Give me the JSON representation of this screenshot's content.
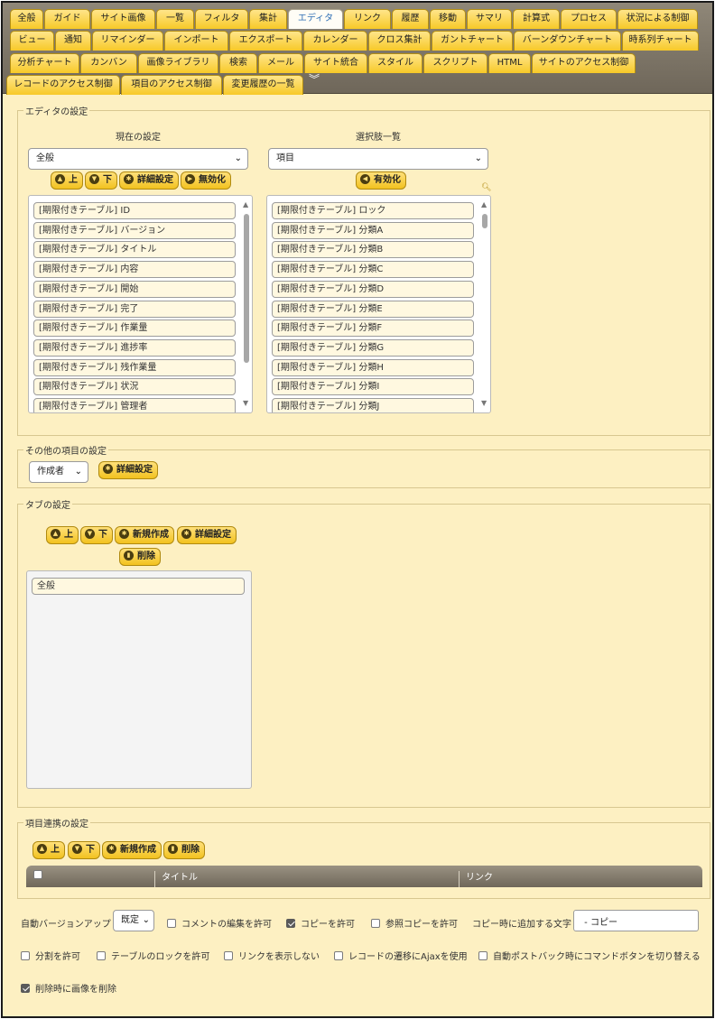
{
  "tabs_row1": [
    "全般",
    "ガイド",
    "サイト画像",
    "一覧",
    "フィルタ",
    "集計",
    "エディタ",
    "リンク",
    "履歴",
    "移動",
    "サマリ",
    "計算式",
    "プロセス",
    "状況による制御"
  ],
  "tabs_row2": [
    "ビュー",
    "通知",
    "リマインダー",
    "インポート",
    "エクスポート",
    "カレンダー",
    "クロス集計",
    "ガントチャート",
    "バーンダウンチャート",
    "時系列チャート"
  ],
  "tabs_row3": [
    "分析チャート",
    "カンバン",
    "画像ライブラリ",
    "検索",
    "メール",
    "サイト統合",
    "スタイル",
    "スクリプト",
    "HTML",
    "サイトのアクセス制御"
  ],
  "tabs_row4": [
    "レコードのアクセス制御",
    "項目のアクセス制御",
    "変更履歴の一覧"
  ],
  "active_tab": "エディタ",
  "editor_settings": {
    "legend": "エディタの設定",
    "current_heading": "現在の設定",
    "choices_heading": "選択肢一覧",
    "current_select": "全般",
    "choices_select": "項目",
    "btn_up": "上",
    "btn_down": "下",
    "btn_advanced": "詳細設定",
    "btn_disable": "無効化",
    "btn_enable": "有効化",
    "current_items": [
      "[期限付きテーブル] ID",
      "[期限付きテーブル] バージョン",
      "[期限付きテーブル] タイトル",
      "[期限付きテーブル] 内容",
      "[期限付きテーブル] 開始",
      "[期限付きテーブル] 完了",
      "[期限付きテーブル] 作業量",
      "[期限付きテーブル] 進捗率",
      "[期限付きテーブル] 残作業量",
      "[期限付きテーブル] 状況",
      "[期限付きテーブル] 管理者"
    ],
    "choice_items": [
      "[期限付きテーブル] ロック",
      "[期限付きテーブル] 分類A",
      "[期限付きテーブル] 分類B",
      "[期限付きテーブル] 分類C",
      "[期限付きテーブル] 分類D",
      "[期限付きテーブル] 分類E",
      "[期限付きテーブル] 分類F",
      "[期限付きテーブル] 分類G",
      "[期限付きテーブル] 分類H",
      "[期限付きテーブル] 分類I",
      "[期限付きテーブル] 分類J"
    ]
  },
  "other_settings": {
    "legend": "その他の項目の設定",
    "select": "作成者",
    "btn_advanced": "詳細設定"
  },
  "tab_settings": {
    "legend": "タブの設定",
    "btn_up": "上",
    "btn_down": "下",
    "btn_new": "新規作成",
    "btn_advanced": "詳細設定",
    "btn_delete": "削除",
    "items": [
      "全般"
    ]
  },
  "link_settings": {
    "legend": "項目連携の設定",
    "btn_up": "上",
    "btn_down": "下",
    "btn_new": "新規作成",
    "btn_delete": "削除",
    "col_title": "タイトル",
    "col_link": "リンク"
  },
  "options": {
    "auto_version_label": "自動バージョンアップ",
    "auto_version_value": "既定",
    "allow_comment_edit": "コメントの編集を許可",
    "allow_copy": "コピーを許可",
    "allow_ref_copy": "参照コピーを許可",
    "copy_suffix_label": "コピー時に追加する文字",
    "copy_suffix_value": " - コピー",
    "allow_split": "分割を許可",
    "allow_lock": "テーブルのロックを許可",
    "hide_link": "リンクを表示しない",
    "ajax_transition": "レコードの遷移にAjaxを使用",
    "switch_command": "自動ポストバック時にコマンドボタンを切り替える",
    "delete_image": "削除時に画像を削除",
    "checked": {
      "allow_comment_edit": false,
      "allow_copy": true,
      "allow_ref_copy": false,
      "allow_split": false,
      "allow_lock": false,
      "hide_link": false,
      "ajax_transition": false,
      "switch_command": false,
      "delete_image": true
    }
  }
}
